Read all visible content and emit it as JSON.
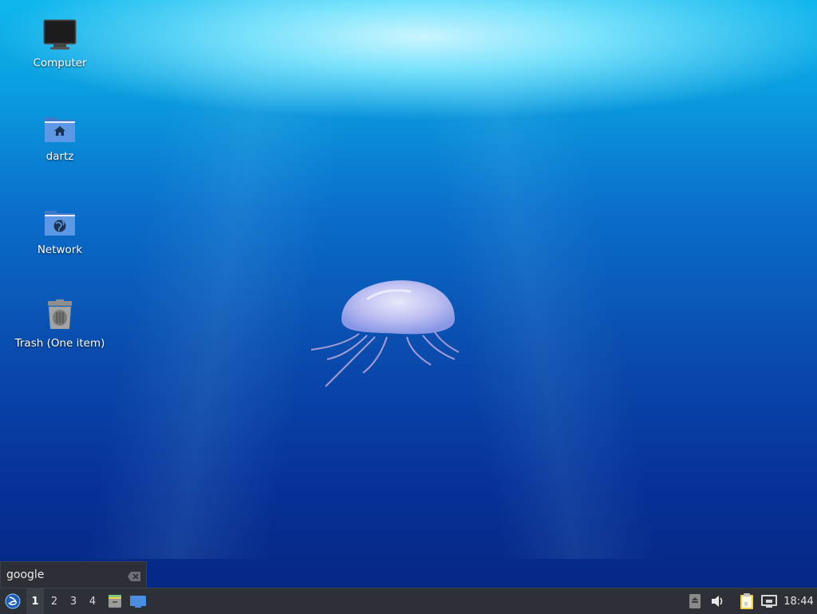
{
  "desktop": {
    "icons": [
      {
        "label": "Computer",
        "icon": "computer-icon"
      },
      {
        "label": "dartz",
        "icon": "home-folder-icon"
      },
      {
        "label": "Network",
        "icon": "network-folder-icon"
      },
      {
        "label": "Trash (One item)",
        "icon": "trash-icon"
      }
    ]
  },
  "search": {
    "value": "google",
    "clear_icon": "clear-text-icon"
  },
  "taskbar": {
    "start_icon": "lubuntu-menu-icon",
    "workspaces": [
      "1",
      "2",
      "3",
      "4"
    ],
    "active_workspace": "1",
    "launchers": [
      "file-manager-icon",
      "show-desktop-icon"
    ],
    "tray": [
      "removable-media-icon",
      "volume-icon",
      "clipboard-icon",
      "network-wired-icon"
    ],
    "clock": "18:44"
  },
  "colors": {
    "taskbar_bg": "#2d3036",
    "search_bg": "#2c2f35",
    "accent": "#3c7fd6"
  }
}
